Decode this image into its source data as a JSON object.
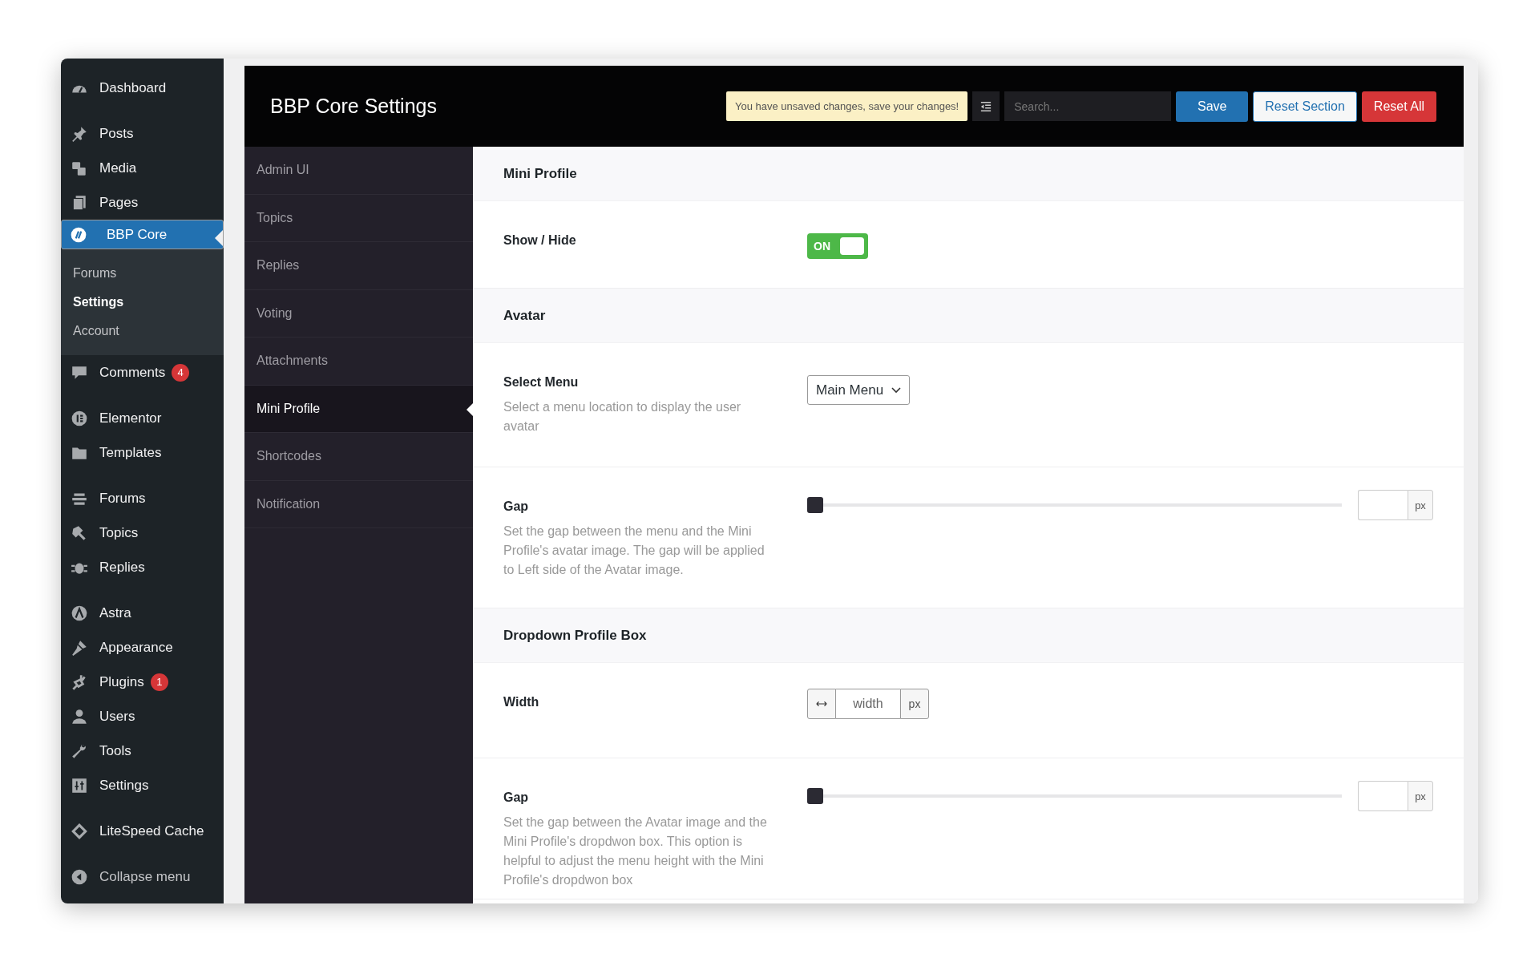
{
  "admin_menu": {
    "groups": [
      [
        {
          "label": "Dashboard",
          "selected": false
        }
      ],
      [
        {
          "label": "Posts",
          "selected": false
        },
        {
          "label": "Media",
          "selected": false
        },
        {
          "label": "Pages",
          "selected": false
        },
        {
          "label": "BBP Core",
          "selected": true,
          "children": [
            {
              "label": "Forums",
              "selected": false
            },
            {
              "label": "Settings",
              "selected": true
            },
            {
              "label": "Account",
              "selected": false
            }
          ]
        },
        {
          "label": "Comments",
          "selected": false,
          "badge": "4"
        }
      ],
      [
        {
          "label": "Elementor",
          "selected": false
        },
        {
          "label": "Templates",
          "selected": false
        }
      ],
      [
        {
          "label": "Forums",
          "selected": false
        },
        {
          "label": "Topics",
          "selected": false
        },
        {
          "label": "Replies",
          "selected": false
        }
      ],
      [
        {
          "label": "Astra",
          "selected": false
        },
        {
          "label": "Appearance",
          "selected": false
        },
        {
          "label": "Plugins",
          "selected": false,
          "badge": "1"
        },
        {
          "label": "Users",
          "selected": false
        },
        {
          "label": "Tools",
          "selected": false
        },
        {
          "label": "Settings",
          "selected": false
        }
      ],
      [
        {
          "label": "LiteSpeed Cache",
          "selected": false
        }
      ]
    ],
    "collapse_label": "Collapse menu"
  },
  "header": {
    "title": "BBP Core Settings",
    "notice": "You have unsaved changes, save your changes!",
    "search": {
      "placeholder": "Search..."
    },
    "buttons": [
      {
        "label": "Save",
        "kind": "primary"
      },
      {
        "label": "Reset Section",
        "kind": "secondary"
      },
      {
        "label": "Reset All",
        "kind": "danger"
      }
    ]
  },
  "nav": {
    "items": [
      {
        "label": "Admin UI",
        "selected": false
      },
      {
        "label": "Topics",
        "selected": false
      },
      {
        "label": "Replies",
        "selected": false
      },
      {
        "label": "Voting",
        "selected": false
      },
      {
        "label": "Attachments",
        "selected": false
      },
      {
        "label": "Mini Profile",
        "selected": true
      },
      {
        "label": "Shortcodes",
        "selected": false
      },
      {
        "label": "Notification",
        "selected": false
      }
    ]
  },
  "sections": [
    {
      "title": "Mini Profile",
      "fields": [
        {
          "kind": "toggle",
          "label": "Show / Hide",
          "on": true,
          "toggle_text": "ON"
        }
      ]
    },
    {
      "title": "Avatar",
      "fields": [
        {
          "kind": "select",
          "label": "Select Menu",
          "description": "Select a menu location to display the user avatar",
          "value": "Main Menu"
        },
        {
          "kind": "slider",
          "label": "Gap",
          "description": "Set the gap between the menu and the Mini Profile's avatar image. The gap will be applied to Left side of the Avatar image.",
          "level": 0,
          "unit": "px"
        }
      ]
    },
    {
      "title": "Dropdown Profile Box",
      "fields": [
        {
          "kind": "dimension",
          "label": "Width",
          "placeholder": "width",
          "unit": "px"
        },
        {
          "kind": "slider",
          "label": "Gap",
          "description": "Set the gap between the Avatar image and the Mini Profile's dropdwon box. This option is helpful to adjust the menu height with the Mini Profile's dropdwon box",
          "level": 0,
          "unit": "px"
        }
      ]
    }
  ]
}
